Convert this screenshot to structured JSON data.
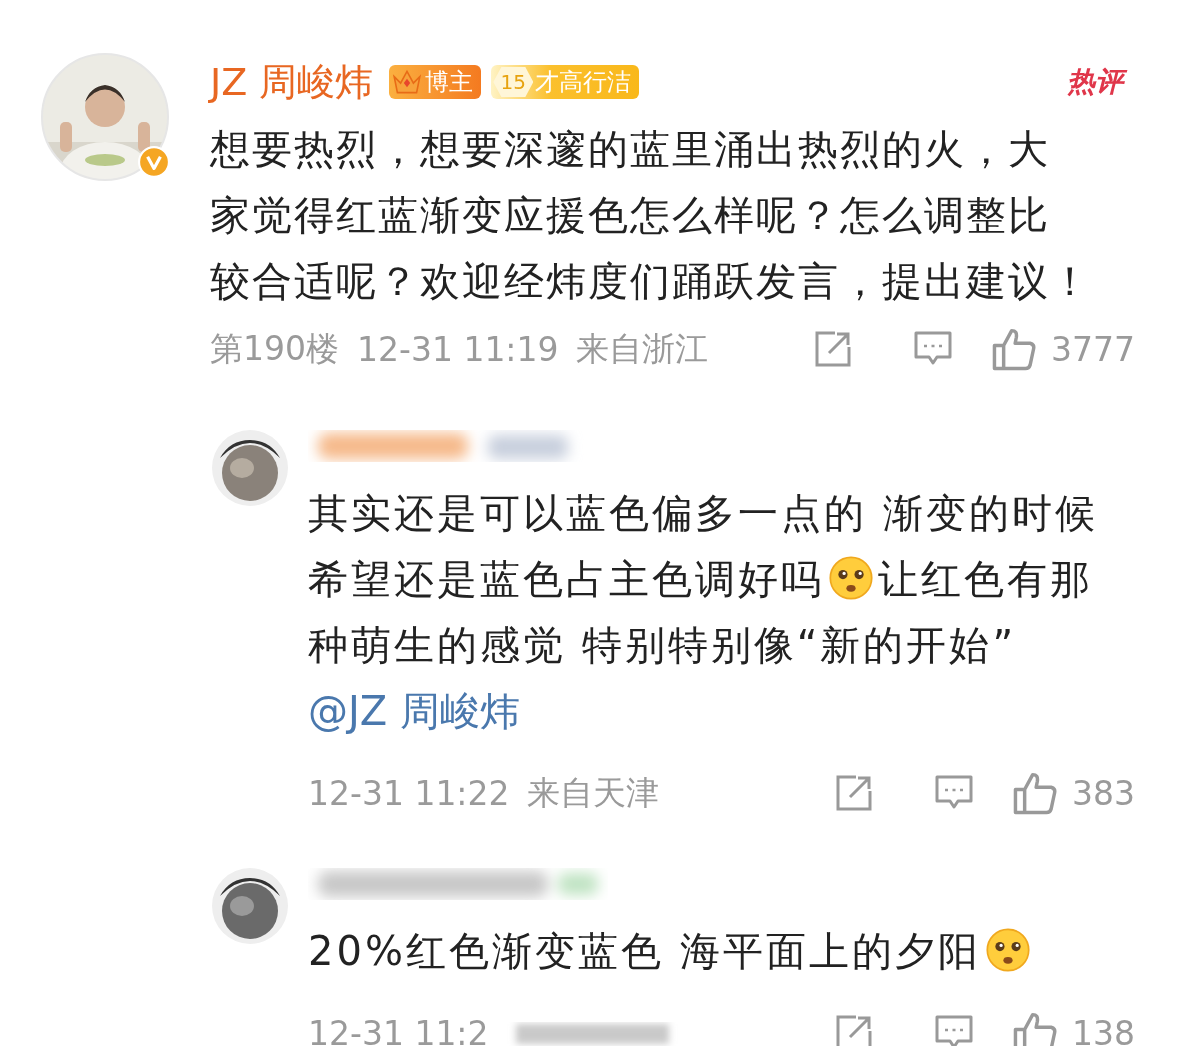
{
  "comments": [
    {
      "kind": "main",
      "author": "JZ 周峻炜",
      "verified": true,
      "badges": [
        {
          "kind": "crown",
          "text": "博主"
        },
        {
          "kind": "fan",
          "number": "15",
          "text": "才高行洁"
        }
      ],
      "tag": "热评",
      "body": [
        [
          {
            "kind": "text",
            "text": "想要热烈，想要深邃的蓝里涌出热烈的火，大"
          }
        ],
        [
          {
            "kind": "text",
            "text": "家觉得红蓝渐变应援色怎么样呢？怎么调整比"
          }
        ],
        [
          {
            "kind": "text",
            "text": "较合适呢？欢迎经炜度们踊跃发言，提出建议！"
          }
        ]
      ],
      "floor": "第190楼",
      "time": "12-31 11:19",
      "location": "来自浙江",
      "likes": "3777"
    },
    {
      "kind": "reply",
      "body": [
        [
          {
            "kind": "text",
            "text": "其实还是可以蓝色偏多一点的 渐变的时候"
          }
        ],
        [
          {
            "kind": "text",
            "text": "希望还是蓝色占主色调好吗"
          },
          {
            "kind": "emoji"
          },
          {
            "kind": "text",
            "text": "让红色有那"
          }
        ],
        [
          {
            "kind": "text",
            "text": "种萌生的感觉 特别特别像“新的开始”"
          }
        ],
        [
          {
            "kind": "mention",
            "text": "@JZ 周峻炜"
          }
        ]
      ],
      "time": "12-31 11:22",
      "location": "来自天津",
      "likes": "383"
    },
    {
      "kind": "reply",
      "body": [
        [
          {
            "kind": "text",
            "text": "20%红色渐变蓝色 海平面上的夕阳"
          },
          {
            "kind": "emoji"
          }
        ]
      ],
      "time": "12-31 11:2",
      "likes": "138"
    }
  ]
}
